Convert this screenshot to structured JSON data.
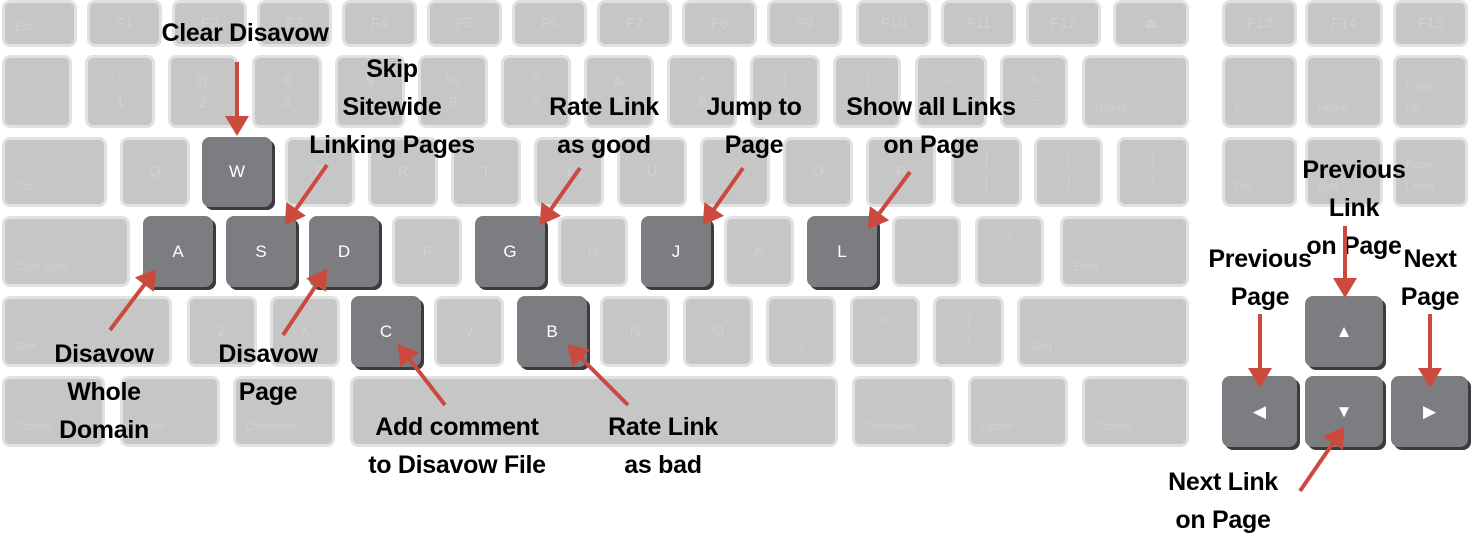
{
  "keys": {
    "esc": "Esc",
    "f1": "F1",
    "f2": "F2",
    "f3": "F3",
    "f4": "F4",
    "f5": "F5",
    "f6": "F6",
    "f7": "F7",
    "f8": "F8",
    "f9": "F9",
    "f10": "F10",
    "f11": "F11",
    "f12": "F12",
    "eject": "⏏",
    "f13": "F13",
    "f14": "F14",
    "f15": "F15",
    "tilde": "~\n`",
    "1": "!\n1",
    "2": "@\n2",
    "3": "#\n3",
    "4": "$\n4",
    "5": "%\n5",
    "6": "^\n6",
    "7": "&\n7",
    "8": "*\n8",
    "9": "(\n9",
    "0": ")\n0",
    "minus": "–\n-",
    "plus": "+\n=",
    "delete": "Delete",
    "fn": "Fn",
    "home": "Home",
    "pageup": "Page\nUp",
    "tab": "Tab",
    "q": "Q",
    "w": "W",
    "e": "E",
    "r": "R",
    "t": "T",
    "y": "Y",
    "u": "U",
    "i": "I",
    "o": "O",
    "p": "P",
    "lbracket": "{\n[",
    "rbracket": "}\n]",
    "backslash": "|\n\\",
    "del": "Del",
    "end": "End",
    "pagedown": "Page\nDown",
    "caps": "Caps Lock",
    "a": "A",
    "s": "S",
    "d": "D",
    "f": "F",
    "g": "G",
    "h": "H",
    "j": "J",
    "k": "K",
    "l": "L",
    "semicolon": ":\n;",
    "quote": "\"\n'",
    "enter": "Enter",
    "shift_l": "Shift",
    "z": "Z",
    "x": "X",
    "c": "C",
    "v": "V",
    "b": "B",
    "n": "N",
    "m": "M",
    "comma": "<\n,",
    "period": ">\n.",
    "slash": "?\n/",
    "shift_r": "Shift",
    "control_l": "Control",
    "option_l": "Option",
    "command_l": "Command",
    "space": "",
    "command_r": "Command",
    "option_r": "Option",
    "control_r": "Control",
    "up": "▲",
    "left": "◀",
    "down": "▼",
    "right": "▶"
  },
  "highlighted_keys": [
    "w",
    "a",
    "s",
    "d",
    "c",
    "g",
    "b",
    "j",
    "l",
    "up",
    "left",
    "down",
    "right"
  ],
  "annotations": {
    "clear_disavow": "Clear Disavow",
    "skip_sitewide": "Skip\nSitewide\nLinking Pages",
    "rate_good": "Rate Link\nas good",
    "jump_to_page": "Jump to\nPage",
    "show_all_links": "Show all Links\non Page",
    "prev_link": "Previous Link\non Page",
    "prev_page": "Previous\nPage",
    "next_page": "Next\nPage",
    "next_link": "Next Link\non Page",
    "disavow_domain": "Disavow\nWhole\nDomain",
    "disavow_page": "Disavow\nPage",
    "add_comment": "Add comment\nto Disavow File",
    "rate_bad": "Rate Link\nas bad"
  },
  "colors": {
    "arrow": "#cc4a3d",
    "key_dim": "#c6c6c6",
    "key_active": "#7b7d80"
  }
}
